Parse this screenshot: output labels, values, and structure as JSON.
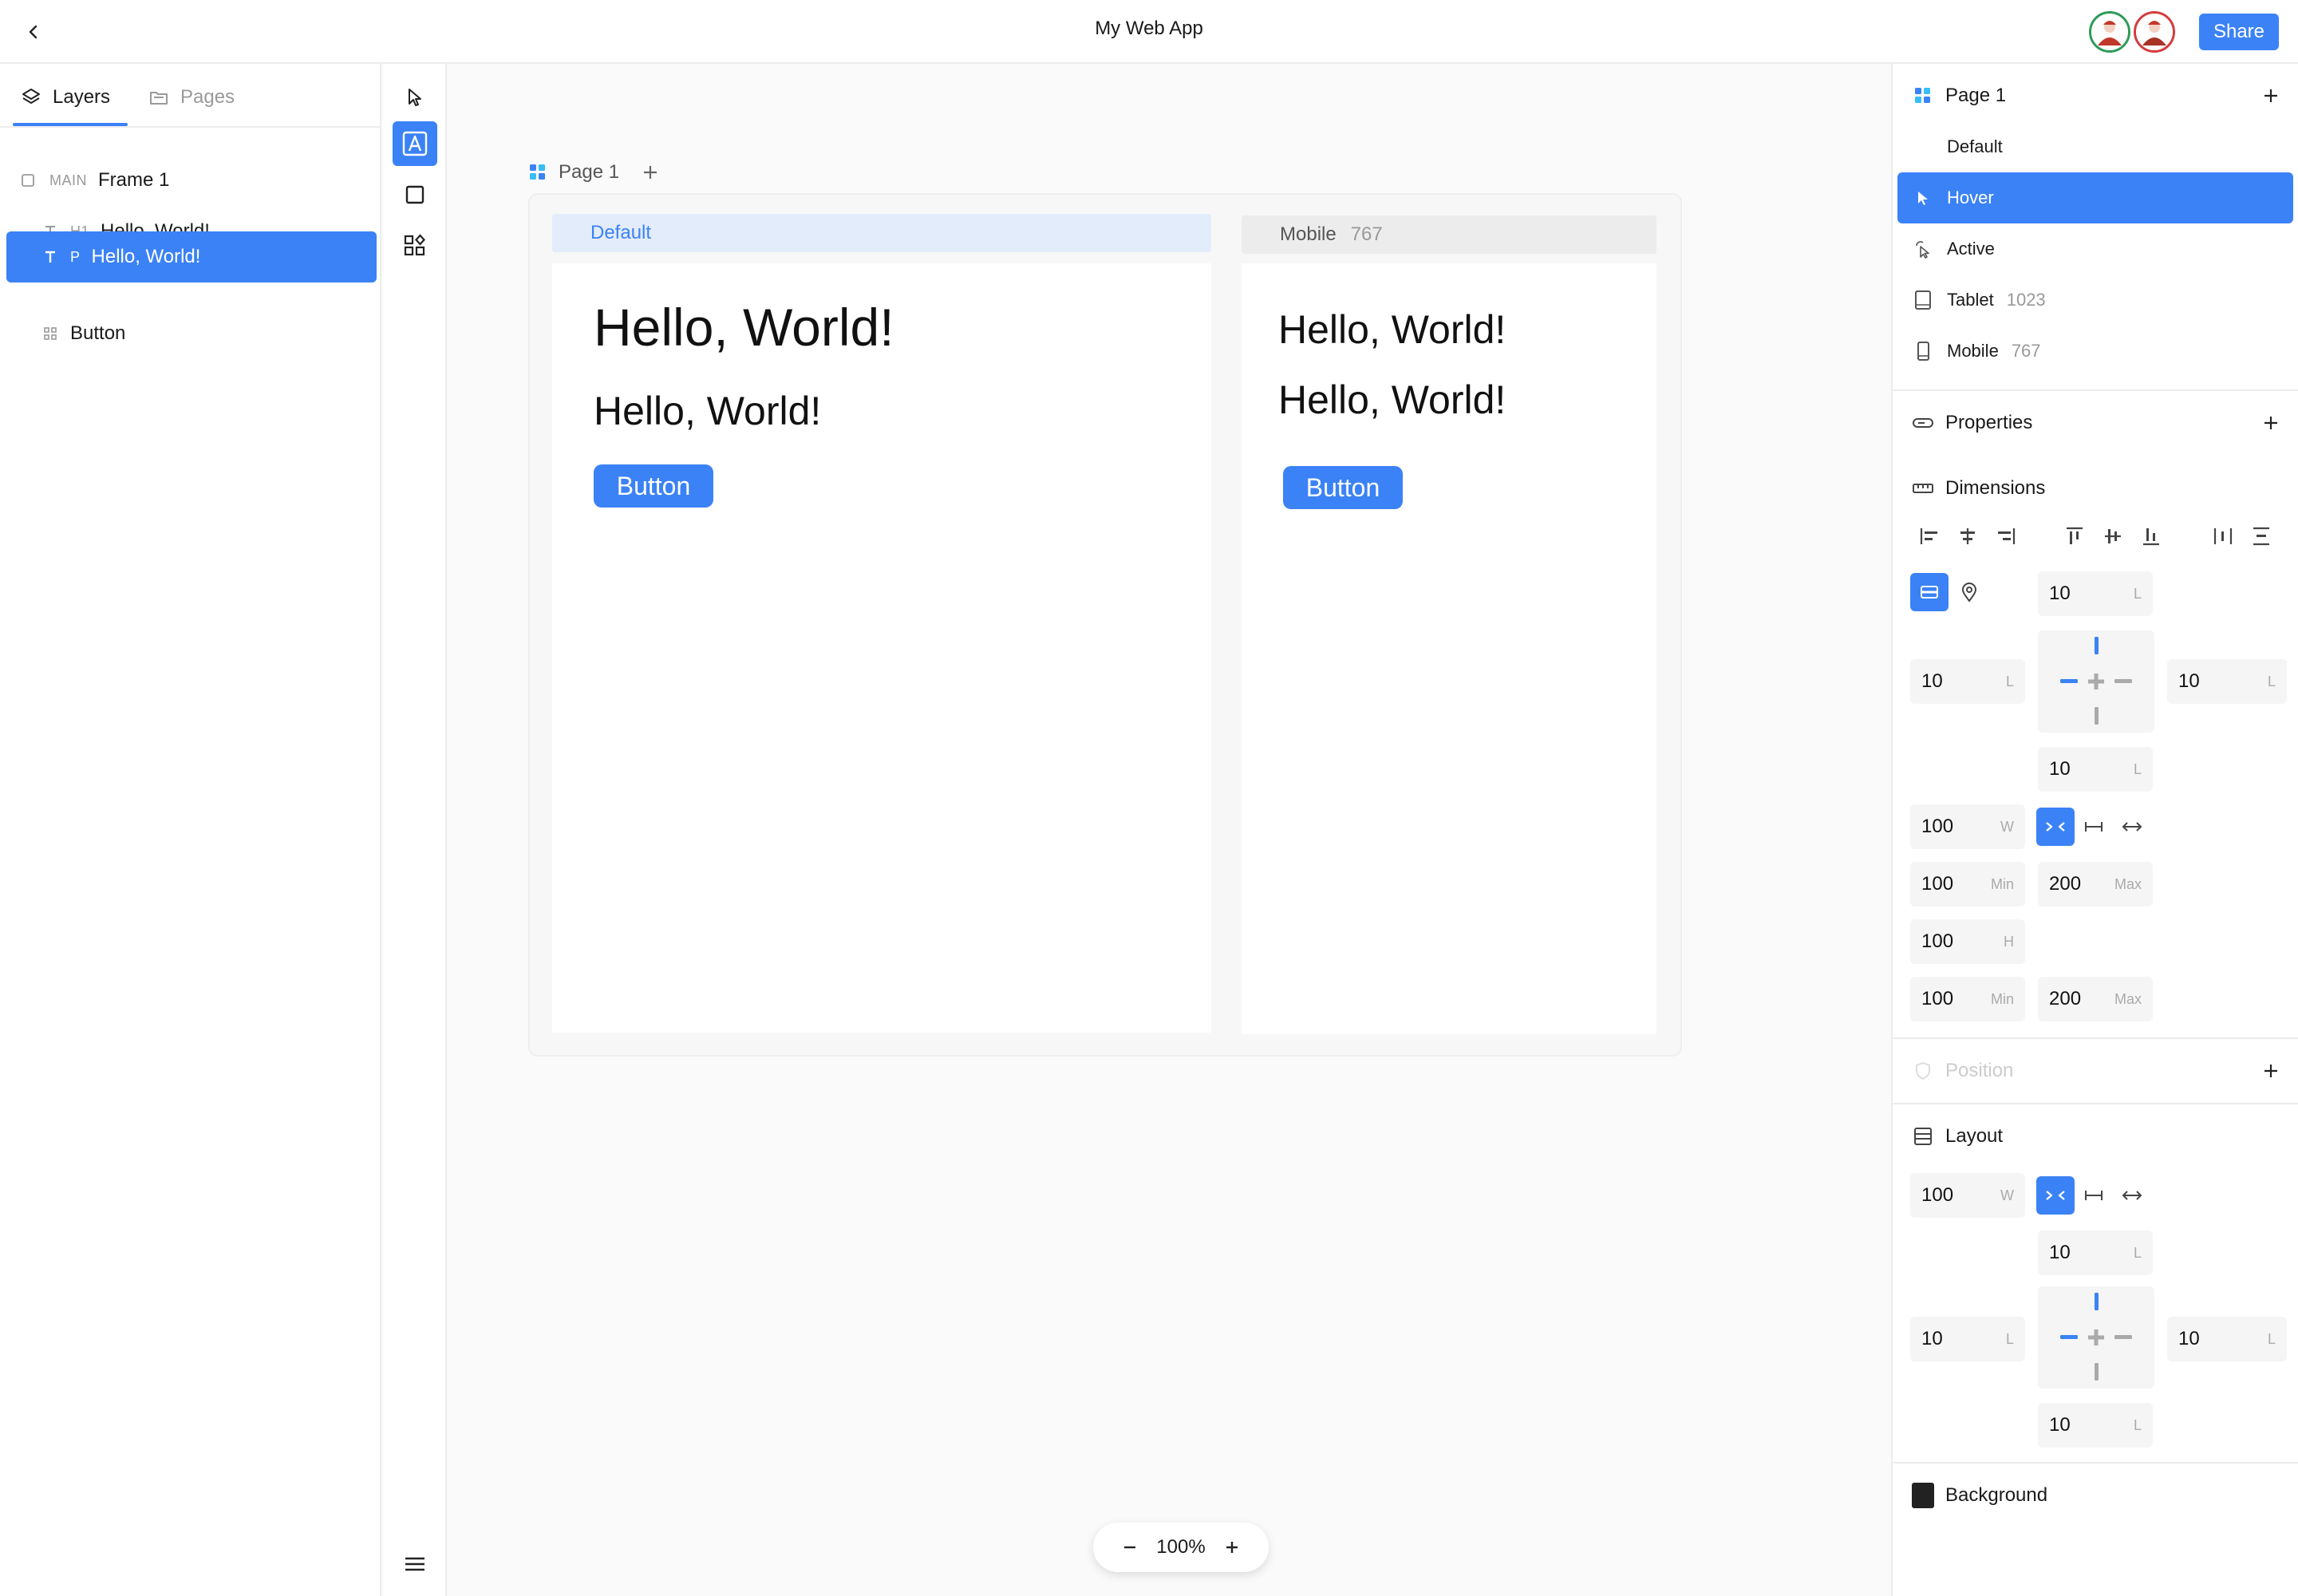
{
  "app": {
    "title": "My Web App",
    "share_label": "Share"
  },
  "left": {
    "tabs": [
      {
        "label": "Layers"
      },
      {
        "label": "Pages"
      }
    ],
    "layers": [
      {
        "tag": "MAIN",
        "name": "Frame 1"
      },
      {
        "tag": "H1",
        "name": "Hello, World!"
      },
      {
        "tag": "P",
        "name": "Hello, World!"
      },
      {
        "tag": "",
        "name": "Button"
      }
    ]
  },
  "canvas": {
    "page_label": "Page 1",
    "breakpoints": [
      {
        "name": "Default",
        "width": ""
      },
      {
        "name": "Mobile",
        "width": "767"
      }
    ],
    "content": {
      "h1": "Hello, World!",
      "p": "Hello, World!",
      "button": "Button"
    },
    "zoom": "100%"
  },
  "right": {
    "page_title": "Page 1",
    "states": [
      {
        "label": "Default",
        "value": "",
        "icon": ""
      },
      {
        "label": "Hover",
        "value": "",
        "icon": "cursor-icon"
      },
      {
        "label": "Active",
        "value": "",
        "icon": "pointer-click-icon"
      },
      {
        "label": "Tablet",
        "value": "1023",
        "icon": "tablet-icon"
      },
      {
        "label": "Mobile",
        "value": "767",
        "icon": "mobile-icon"
      }
    ],
    "sections": {
      "properties": "Properties",
      "dimensions": "Dimensions",
      "position": "Position",
      "layout": "Layout",
      "background": "Background"
    },
    "dimensions": {
      "margin_top": "10",
      "margin_left": "10",
      "margin_right": "10",
      "margin_bottom": "10",
      "unit_l": "L",
      "width": "100",
      "unit_w": "W",
      "min_w": "100",
      "max_w": "200",
      "height": "100",
      "unit_h": "H",
      "min_h": "100",
      "max_h": "200",
      "unit_min": "Min",
      "unit_max": "Max"
    },
    "layout": {
      "width": "100",
      "unit_w": "W",
      "pad_top": "10",
      "pad_left": "10",
      "pad_right": "10",
      "pad_bottom": "10",
      "unit_l": "L"
    },
    "colors": {
      "accent": "#3b82f6",
      "background_swatch": "#222222"
    }
  }
}
